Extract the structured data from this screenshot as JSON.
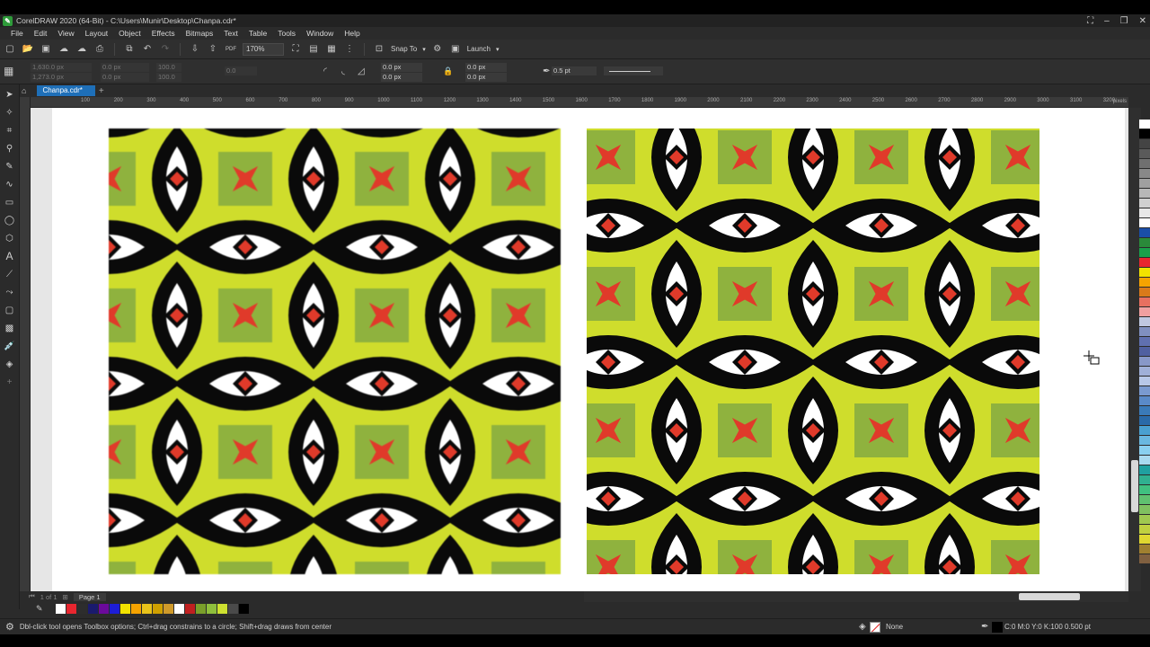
{
  "window": {
    "title": "CorelDRAW 2020 (64-Bit) - C:\\Users\\Munir\\Desktop\\Chanpa.cdr*"
  },
  "menu": [
    "File",
    "Edit",
    "View",
    "Layout",
    "Object",
    "Effects",
    "Bitmaps",
    "Text",
    "Table",
    "Tools",
    "Window",
    "Help"
  ],
  "toolbar": {
    "zoom_value": "170%",
    "snap_label": "Snap To",
    "launch_label": "Launch"
  },
  "property_bar": {
    "x_value": "1,630.0 px",
    "y_value": "1,273.0 px",
    "w_value": "0.0 px",
    "h_value": "0.0 px",
    "sx_value": "100.0",
    "sy_value": "100.0",
    "angle_value": "0.0",
    "corner_1": "0.0 px",
    "corner_2": "0.0 px",
    "corner_3": "0.0 px",
    "corner_4": "0.0 px",
    "outline_width": "0.5 pt"
  },
  "document_tab": "Chanpa.cdr*",
  "ruler": {
    "h_labels": [
      "100",
      "200",
      "300",
      "400",
      "500",
      "600",
      "700",
      "800",
      "900",
      "1000",
      "1100",
      "1200",
      "1300",
      "1400",
      "1500",
      "1600",
      "1700",
      "1800",
      "1900",
      "2000",
      "2100",
      "2200",
      "2300",
      "2400",
      "2500",
      "2600",
      "2700",
      "2800",
      "2900",
      "3000",
      "3100",
      "3200"
    ],
    "units": "pixels"
  },
  "page_nav": {
    "page_counter": "1 of 1",
    "page_tab": "Page 1"
  },
  "status": {
    "hint": "Dbl-click tool opens Toolbox options; Ctrl+drag constrains to a circle; Shift+drag draws from center",
    "fill_label": "None",
    "outline_info": "C:0 M:0 Y:0 K:100  0.500 pt"
  },
  "colors": {
    "pattern_yellow": "#cfdd2c",
    "pattern_green": "#8fb23e",
    "pattern_red": "#e03a2a",
    "pattern_black": "#0a0a0a",
    "accent_tab": "#1e6fb8"
  },
  "palette_bottom": [
    "#ffffff",
    "#e8262f",
    "#2d2d2d",
    "#1a1a6e",
    "#6b0a9c",
    "#1d1dd6",
    "#f2e200",
    "#f5a300",
    "#e8c21a",
    "#cfa000",
    "#cf9a2a",
    "#ffffff",
    "#c02020",
    "#7a9f2a",
    "#8fbf3c",
    "#cde030",
    "#4a4a4a",
    "#000000"
  ],
  "palette_right": [
    "#ffffff",
    "#000000",
    "#444444",
    "#5a5a5a",
    "#707070",
    "#888888",
    "#a0a0a0",
    "#b8b8b8",
    "#d0d0d0",
    "#e8e8e8",
    "#ffffff",
    "#1a4ea8",
    "#2a8a3a",
    "#1aa04a",
    "#e8262f",
    "#f2e200",
    "#f5a300",
    "#d97a1a",
    "#e87060",
    "#f0a0a0",
    "#c0c8e0",
    "#8090c0",
    "#6070b0",
    "#5060a0",
    "#8898c8",
    "#a0b0d8",
    "#b8c8e8",
    "#7a9ad0",
    "#5a8ac8",
    "#3a7ab8",
    "#2a6aa8",
    "#4aa0d0",
    "#6ab8e0",
    "#8ad0f0",
    "#aadaf0",
    "#20a0a0",
    "#30b090",
    "#40c080",
    "#60c070",
    "#80c060",
    "#a0c850",
    "#c0d040",
    "#e0d830",
    "#a08030",
    "#806040"
  ]
}
